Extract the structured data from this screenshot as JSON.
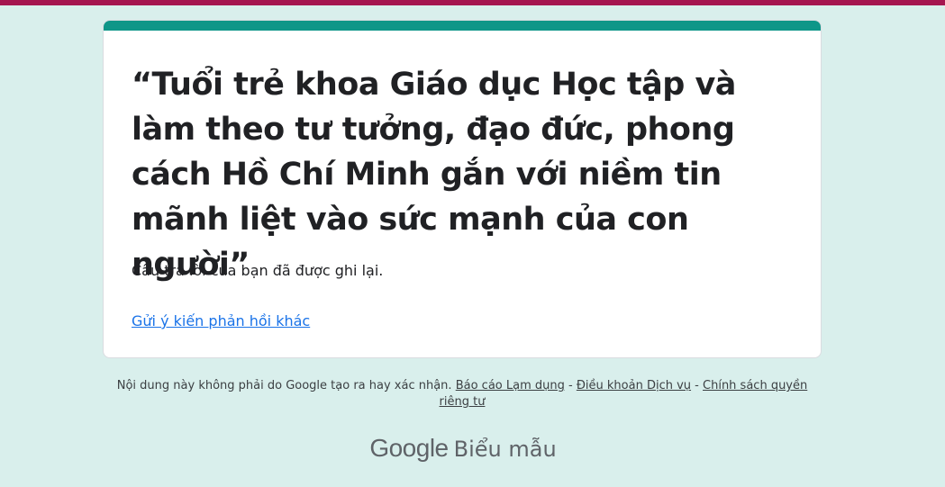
{
  "form": {
    "title": "“Tuổi trẻ khoa Giáo dục Học tập và làm theo tư tưởng, đạo đức, phong cách Hồ Chí Minh gắn với niềm tin mãnh liệt vào sức mạnh của con người”",
    "confirmation": "Câu trả lời của bạn đã được ghi lại.",
    "submit_another": "Gửi ý kiến phản hồi khác"
  },
  "footer": {
    "disclaimer": "Nội dung này không phải do Google tạo ra hay xác nhận.",
    "report_abuse": "Báo cáo Lạm dụng",
    "terms": "Điều khoản Dịch vụ",
    "privacy": "Chính sách quyền riêng tư",
    "separator": " - "
  },
  "brand": {
    "google": "Google",
    "product": "Biểu mẫu"
  },
  "colors": {
    "page_background": "#d9efec",
    "top_strip": "#a5154f",
    "card_accent": "#0e9688",
    "link": "#1a73e8"
  }
}
